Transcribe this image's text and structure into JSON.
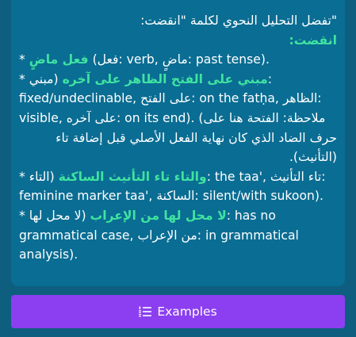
{
  "card": {
    "intro": "\"تفضل التحليل النحوي لكلمة \"انقضت:",
    "heading": "انقضت:",
    "line1": {
      "bullet": "* ",
      "ar": "فعل ماضٍ",
      "rest": " (فعل: verb, ماضٍ: past tense)."
    },
    "line2": {
      "bullet": "* ",
      "ar": "مبني على الفتح الظاهر على آخره",
      "rest": " (مبني:"
    },
    "line3": "fixed/undeclinable, على الفتح: on the fatḥa, الظاهر:",
    "line4": "visible, على آخره: on its end). (ملاحظة: الفتحة هنا على",
    "line5": "حرف الضاد الذي كان نهاية الفعل الأصلي قبل إضافة تاء",
    "line6": "(التأنيث).",
    "line7": {
      "bullet": "* ",
      "ar": "والتاء تاء التأنيث الساكنة",
      "rest": " (التاء: the taa', تاء التأنيث:"
    },
    "line8": "feminine marker taa', الساكنة: silent/with sukoon).",
    "line9": {
      "bullet": "* ",
      "ar": "لا محل لها من الإعراب",
      "rest": " (لا محل لها: has no"
    },
    "line10": "grammatical case, من الإعراب: in grammatical",
    "line11": "analysis)."
  },
  "button": {
    "label": "Examples",
    "icon": "list-ordered-icon"
  },
  "colors": {
    "page_bg": "#0e5f7f",
    "card_bg": "#0a6d93",
    "highlight": "#3fe3a1",
    "button_bg": "#8b3ff0"
  }
}
